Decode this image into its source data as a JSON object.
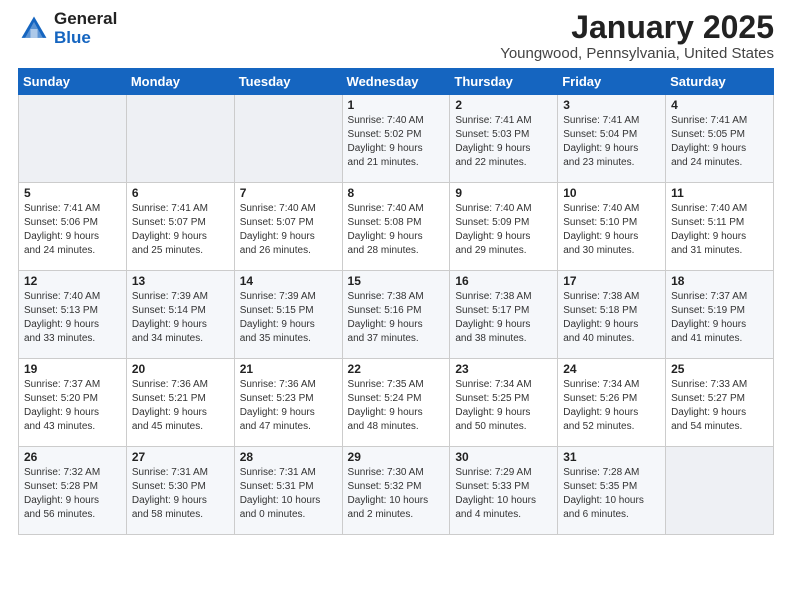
{
  "header": {
    "logo_general": "General",
    "logo_blue": "Blue",
    "month_title": "January 2025",
    "location": "Youngwood, Pennsylvania, United States"
  },
  "weekdays": [
    "Sunday",
    "Monday",
    "Tuesday",
    "Wednesday",
    "Thursday",
    "Friday",
    "Saturday"
  ],
  "weeks": [
    [
      {
        "day": "",
        "info": ""
      },
      {
        "day": "",
        "info": ""
      },
      {
        "day": "",
        "info": ""
      },
      {
        "day": "1",
        "info": "Sunrise: 7:40 AM\nSunset: 5:02 PM\nDaylight: 9 hours\nand 21 minutes."
      },
      {
        "day": "2",
        "info": "Sunrise: 7:41 AM\nSunset: 5:03 PM\nDaylight: 9 hours\nand 22 minutes."
      },
      {
        "day": "3",
        "info": "Sunrise: 7:41 AM\nSunset: 5:04 PM\nDaylight: 9 hours\nand 23 minutes."
      },
      {
        "day": "4",
        "info": "Sunrise: 7:41 AM\nSunset: 5:05 PM\nDaylight: 9 hours\nand 24 minutes."
      }
    ],
    [
      {
        "day": "5",
        "info": "Sunrise: 7:41 AM\nSunset: 5:06 PM\nDaylight: 9 hours\nand 24 minutes."
      },
      {
        "day": "6",
        "info": "Sunrise: 7:41 AM\nSunset: 5:07 PM\nDaylight: 9 hours\nand 25 minutes."
      },
      {
        "day": "7",
        "info": "Sunrise: 7:40 AM\nSunset: 5:07 PM\nDaylight: 9 hours\nand 26 minutes."
      },
      {
        "day": "8",
        "info": "Sunrise: 7:40 AM\nSunset: 5:08 PM\nDaylight: 9 hours\nand 28 minutes."
      },
      {
        "day": "9",
        "info": "Sunrise: 7:40 AM\nSunset: 5:09 PM\nDaylight: 9 hours\nand 29 minutes."
      },
      {
        "day": "10",
        "info": "Sunrise: 7:40 AM\nSunset: 5:10 PM\nDaylight: 9 hours\nand 30 minutes."
      },
      {
        "day": "11",
        "info": "Sunrise: 7:40 AM\nSunset: 5:11 PM\nDaylight: 9 hours\nand 31 minutes."
      }
    ],
    [
      {
        "day": "12",
        "info": "Sunrise: 7:40 AM\nSunset: 5:13 PM\nDaylight: 9 hours\nand 33 minutes."
      },
      {
        "day": "13",
        "info": "Sunrise: 7:39 AM\nSunset: 5:14 PM\nDaylight: 9 hours\nand 34 minutes."
      },
      {
        "day": "14",
        "info": "Sunrise: 7:39 AM\nSunset: 5:15 PM\nDaylight: 9 hours\nand 35 minutes."
      },
      {
        "day": "15",
        "info": "Sunrise: 7:38 AM\nSunset: 5:16 PM\nDaylight: 9 hours\nand 37 minutes."
      },
      {
        "day": "16",
        "info": "Sunrise: 7:38 AM\nSunset: 5:17 PM\nDaylight: 9 hours\nand 38 minutes."
      },
      {
        "day": "17",
        "info": "Sunrise: 7:38 AM\nSunset: 5:18 PM\nDaylight: 9 hours\nand 40 minutes."
      },
      {
        "day": "18",
        "info": "Sunrise: 7:37 AM\nSunset: 5:19 PM\nDaylight: 9 hours\nand 41 minutes."
      }
    ],
    [
      {
        "day": "19",
        "info": "Sunrise: 7:37 AM\nSunset: 5:20 PM\nDaylight: 9 hours\nand 43 minutes."
      },
      {
        "day": "20",
        "info": "Sunrise: 7:36 AM\nSunset: 5:21 PM\nDaylight: 9 hours\nand 45 minutes."
      },
      {
        "day": "21",
        "info": "Sunrise: 7:36 AM\nSunset: 5:23 PM\nDaylight: 9 hours\nand 47 minutes."
      },
      {
        "day": "22",
        "info": "Sunrise: 7:35 AM\nSunset: 5:24 PM\nDaylight: 9 hours\nand 48 minutes."
      },
      {
        "day": "23",
        "info": "Sunrise: 7:34 AM\nSunset: 5:25 PM\nDaylight: 9 hours\nand 50 minutes."
      },
      {
        "day": "24",
        "info": "Sunrise: 7:34 AM\nSunset: 5:26 PM\nDaylight: 9 hours\nand 52 minutes."
      },
      {
        "day": "25",
        "info": "Sunrise: 7:33 AM\nSunset: 5:27 PM\nDaylight: 9 hours\nand 54 minutes."
      }
    ],
    [
      {
        "day": "26",
        "info": "Sunrise: 7:32 AM\nSunset: 5:28 PM\nDaylight: 9 hours\nand 56 minutes."
      },
      {
        "day": "27",
        "info": "Sunrise: 7:31 AM\nSunset: 5:30 PM\nDaylight: 9 hours\nand 58 minutes."
      },
      {
        "day": "28",
        "info": "Sunrise: 7:31 AM\nSunset: 5:31 PM\nDaylight: 10 hours\nand 0 minutes."
      },
      {
        "day": "29",
        "info": "Sunrise: 7:30 AM\nSunset: 5:32 PM\nDaylight: 10 hours\nand 2 minutes."
      },
      {
        "day": "30",
        "info": "Sunrise: 7:29 AM\nSunset: 5:33 PM\nDaylight: 10 hours\nand 4 minutes."
      },
      {
        "day": "31",
        "info": "Sunrise: 7:28 AM\nSunset: 5:35 PM\nDaylight: 10 hours\nand 6 minutes."
      },
      {
        "day": "",
        "info": ""
      }
    ]
  ]
}
